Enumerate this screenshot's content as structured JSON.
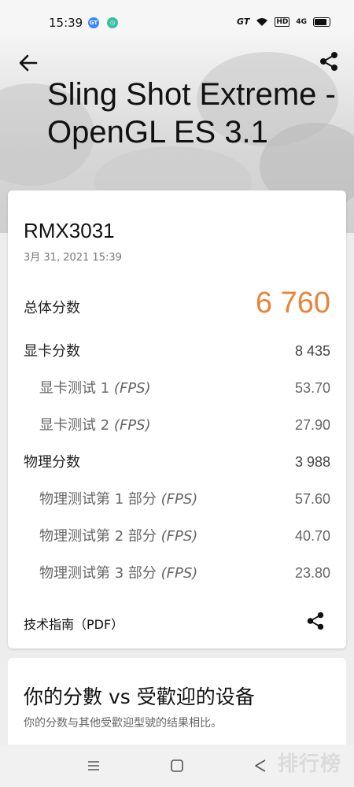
{
  "status_bar": {
    "time": "15:39",
    "indicators": [
      "GT",
      "wifi",
      "HD",
      "4G"
    ]
  },
  "header": {
    "title": "Sling Shot Extreme - OpenGL ES 3.1"
  },
  "result": {
    "device": "RMX3031",
    "date": "3月 31, 2021 15:39",
    "total": {
      "label": "总体分数",
      "value": "6 760"
    },
    "graphics": {
      "label": "显卡分数",
      "value": "8 435"
    },
    "graphics_tests": [
      {
        "label": "显卡测试 1",
        "unit": "(FPS)",
        "value": "53.70"
      },
      {
        "label": "显卡测试 2",
        "unit": "(FPS)",
        "value": "27.90"
      }
    ],
    "physics": {
      "label": "物理分数",
      "value": "3 988"
    },
    "physics_tests": [
      {
        "label": "物理测试第 1 部分",
        "unit": "(FPS)",
        "value": "57.60"
      },
      {
        "label": "物理测试第 2 部分",
        "unit": "(FPS)",
        "value": "40.70"
      },
      {
        "label": "物理测试第 3 部分",
        "unit": "(FPS)",
        "value": "23.80"
      }
    ],
    "guide_label": "技术指南（PDF）"
  },
  "comparison": {
    "title": "你的分數 vs 受歡迎的设备",
    "subtitle": "你的分数与其他受歡迎型號的结果相比。"
  },
  "watermark": "排行榜",
  "colors": {
    "accent": "#e8833a"
  }
}
